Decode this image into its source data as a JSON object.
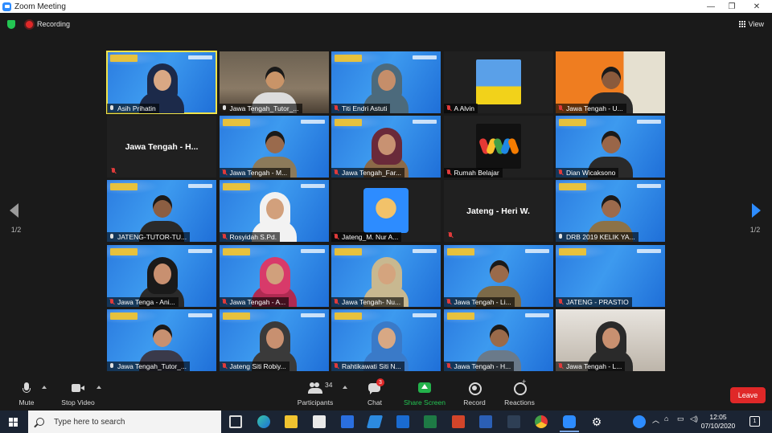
{
  "window": {
    "title": "Zoom Meeting"
  },
  "top_bar": {
    "recording_label": "Recording",
    "view_label": "View"
  },
  "pagination": {
    "left": "1/2",
    "right": "1/2"
  },
  "tiles": [
    {
      "name": "Asih Prihatin",
      "muted": false,
      "style": "blue",
      "skin": "#d9a884",
      "hijab": "#1c2a4a",
      "body": "#1c2a4a"
    },
    {
      "name": "Jawa Tengah_Tutor_...",
      "muted": false,
      "style": "home",
      "skin": "#c99468",
      "hijab": "",
      "body": "#dcdcdc"
    },
    {
      "name": "Titi Endri Astuti",
      "muted": true,
      "style": "blue",
      "skin": "#c58e6a",
      "hijab": "#4c6a7c",
      "body": "#4c6a7c"
    },
    {
      "name": "A Alvin",
      "muted": true,
      "style": "dark",
      "avatar": "alvin"
    },
    {
      "name": "Jawa Tengah - U...",
      "muted": true,
      "style": "orange",
      "skin": "#8a5a3c",
      "hijab": "",
      "body": "#2b2b2b"
    },
    {
      "name": "Jawa Tengah - H...",
      "muted": true,
      "style": "dark",
      "center_label": "Jawa Tengah - H..."
    },
    {
      "name": "Jawa Tengah - M...",
      "muted": true,
      "style": "blue",
      "skin": "#9a6a4c",
      "hijab": "",
      "body": "#8c7a5a"
    },
    {
      "name": "Jawa Tengah_Far...",
      "muted": true,
      "style": "blue",
      "skin": "#c89272",
      "hijab": "#6a2a3a",
      "body": "#8c6a48"
    },
    {
      "name": "Rumah Belajar",
      "muted": true,
      "style": "dark",
      "avatar": "brand"
    },
    {
      "name": "Dian Wicaksono",
      "muted": true,
      "style": "blue",
      "skin": "#9a6648",
      "hijab": "",
      "body": "#2a2a2a"
    },
    {
      "name": "JATENG-TUTOR-TU...",
      "muted": false,
      "style": "blue",
      "skin": "#8c5e42",
      "hijab": "",
      "body": "#2a2a2a"
    },
    {
      "name": "Rosyidah S.Pd.",
      "muted": true,
      "style": "blue",
      "skin": "#d2a07c",
      "hijab": "#f2f2f2",
      "body": "#f2f2f2"
    },
    {
      "name": "Jateng_M. Nur A...",
      "muted": true,
      "style": "dark",
      "avatar": "badge"
    },
    {
      "name": "Jateng - Heri W.",
      "muted": true,
      "style": "dark",
      "center_label": "Jateng - Heri W."
    },
    {
      "name": "DRB 2019 KELIK YA...",
      "muted": false,
      "style": "blue",
      "skin": "#9c6a4c",
      "hijab": "",
      "body": "#8c7248"
    },
    {
      "name": "Jawa Tenga - Ani...",
      "muted": true,
      "style": "blue",
      "skin": "#c89070",
      "hijab": "#1a1a1a",
      "body": "#2a2a2a"
    },
    {
      "name": "Jawa Tengah - A...",
      "muted": true,
      "style": "blue",
      "skin": "#d0a07c",
      "hijab": "#d83a6a",
      "body": "#b02a52"
    },
    {
      "name": "Jawa Tengah- Nu...",
      "muted": true,
      "style": "blue",
      "skin": "#d4a47e",
      "hijab": "#c8b890",
      "body": "#c8b890"
    },
    {
      "name": "Jawa Tengah - Li...",
      "muted": true,
      "style": "blue",
      "skin": "#9a6a4a",
      "hijab": "",
      "body": "#7c6a48"
    },
    {
      "name": "JATENG - PRASTIO",
      "muted": true,
      "style": "blue",
      "skin": "",
      "hijab": "",
      "body": ""
    },
    {
      "name": "Jawa Tengah_Tutor_...",
      "muted": false,
      "style": "blue",
      "skin": "#c89070",
      "hijab": "",
      "body": "#3a3a4a"
    },
    {
      "name": "Jateng Siti Robiy...",
      "muted": true,
      "style": "blue",
      "skin": "#c89070",
      "hijab": "#3a3a3a",
      "body": "#3a3a3a"
    },
    {
      "name": "Rahtikawati Siti N...",
      "muted": true,
      "style": "blue",
      "skin": "#d8a884",
      "hijab": "#3a7ac8",
      "body": "#3a7ac8"
    },
    {
      "name": "Jawa Tengah - H...",
      "muted": true,
      "style": "blue",
      "skin": "#9a6a4a",
      "hijab": "",
      "body": "#6a7a8a"
    },
    {
      "name": "Jawa Tengah - L...",
      "muted": true,
      "style": "car",
      "skin": "#c89070",
      "hijab": "#2a2a2a",
      "body": "#2a2a2a"
    }
  ],
  "toolbar": {
    "mute": "Mute",
    "stop_video": "Stop Video",
    "participants": "Participants",
    "participants_count": "34",
    "chat": "Chat",
    "chat_badge": "3",
    "share_screen": "Share Screen",
    "record": "Record",
    "reactions": "Reactions",
    "leave": "Leave"
  },
  "taskbar": {
    "search_placeholder": "Type here to search",
    "time": "12:05",
    "date": "07/10/2020",
    "notification_count": "1"
  }
}
